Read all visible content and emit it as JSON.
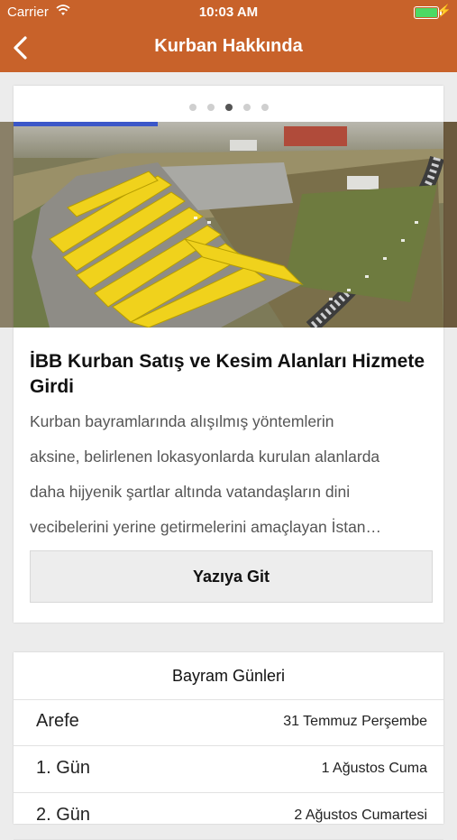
{
  "status_bar": {
    "carrier": "Carrier",
    "time": "10:03 AM"
  },
  "nav": {
    "title": "Kurban Hakkında",
    "back_icon": "chevron-left-icon"
  },
  "carousel": {
    "page_count": 5,
    "active_index": 2
  },
  "article": {
    "title": "İBB Kurban Satış ve Kesim Alanları Hizmete Girdi",
    "body_lines": [
      "Kurban bayramlarında alışılmış yöntemlerin",
      "aksine, belirlenen lokasyonlarda kurulan alanlarda",
      "daha hijyenik şartlar altında vatandaşların dini",
      "vecibelerini yerine getirmelerini amaçlayan İstan…"
    ],
    "button_label": "Yazıya Git"
  },
  "holidays": {
    "title": "Bayram Günleri",
    "rows": [
      {
        "label": "Arefe",
        "value": "31 Temmuz Perşembe"
      },
      {
        "label": "1. Gün",
        "value": "1 Ağustos Cuma"
      },
      {
        "label": "2. Gün",
        "value": "2 Ağustos Cumartesi"
      }
    ]
  },
  "colors": {
    "nav_bar": "#c8622a",
    "background": "#ececec",
    "battery": "#4cd964"
  }
}
